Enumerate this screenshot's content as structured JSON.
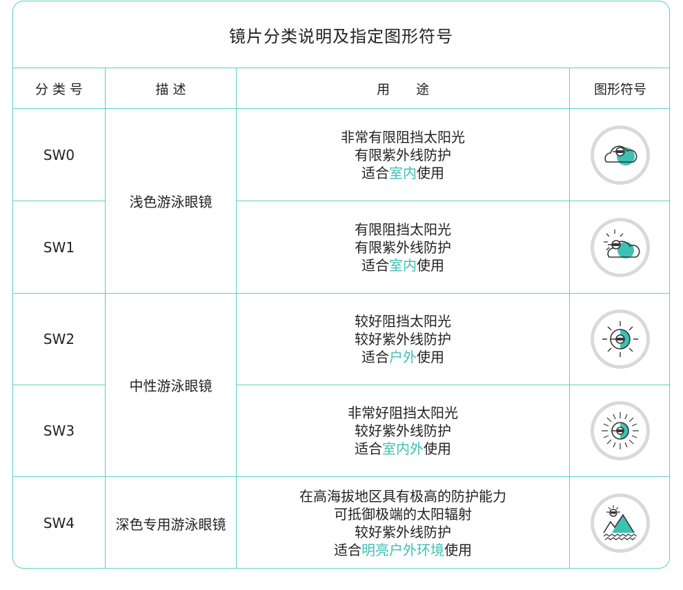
{
  "title": "镜片分类说明及指定图形符号",
  "headers": {
    "category": "分 类 号",
    "description": "描 述",
    "usage": "用　　途",
    "symbol": "图形符号"
  },
  "groups": {
    "light": "浅色游泳眼镜",
    "medium": "中性游泳眼镜",
    "dark": "深色专用游泳眼镜"
  },
  "rows": [
    {
      "code": "SW0",
      "line1": "非常有限阻挡太阳光",
      "line2": "有限紫外线防护",
      "pre": "适合",
      "hl": "室内",
      "post": "使用",
      "icon": "cloud-goggle-icon"
    },
    {
      "code": "SW1",
      "line1": "有限阻挡太阳光",
      "line2": "有限紫外线防护",
      "pre": "适合",
      "hl": "室内",
      "post": "使用",
      "icon": "sun-cloud-goggle-icon"
    },
    {
      "code": "SW2",
      "line1": "较好阻挡太阳光",
      "line2": "较好紫外线防护",
      "pre": "适合",
      "hl": "户外",
      "post": "使用",
      "icon": "sun-goggle-icon"
    },
    {
      "code": "SW3",
      "line1": "非常好阻挡太阳光",
      "line2": "较好紫外线防护",
      "pre": "适合",
      "hl": "室内外",
      "post": "使用",
      "icon": "bright-sun-goggle-icon"
    },
    {
      "code": "SW4",
      "line1": "在高海拔地区具有极高的防护能力",
      "line2": "可抵御极端的太阳辐射",
      "line3": "较好紫外线防护",
      "pre": "适合",
      "hl": "明亮户外环境",
      "post": "使用",
      "icon": "mountain-sun-goggle-icon"
    }
  ],
  "colors": {
    "accent": "#3dc1b3",
    "border": "#5ccfc3",
    "icon_ring": "#d9d9d9",
    "text": "#222222"
  }
}
